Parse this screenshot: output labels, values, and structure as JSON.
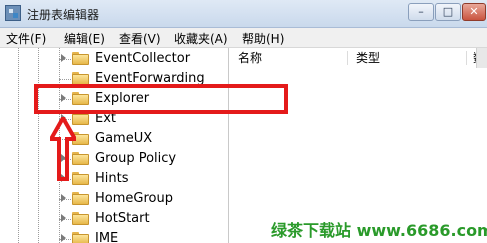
{
  "window": {
    "title": "注册表编辑器"
  },
  "menu": {
    "items": [
      {
        "label": "文件(F)"
      },
      {
        "label": "编辑(E)"
      },
      {
        "label": "查看(V)"
      },
      {
        "label": "收藏夹(A)"
      },
      {
        "label": "帮助(H)"
      }
    ]
  },
  "tree": {
    "items": [
      {
        "label": "EventCollector"
      },
      {
        "label": "EventForwarding"
      },
      {
        "label": "Explorer"
      },
      {
        "label": "Ext"
      },
      {
        "label": "GameUX"
      },
      {
        "label": "Group Policy"
      },
      {
        "label": "Hints"
      },
      {
        "label": "HomeGroup"
      },
      {
        "label": "HotStart"
      },
      {
        "label": "IME"
      }
    ]
  },
  "list": {
    "columns": [
      {
        "label": "名称"
      },
      {
        "label": "类型"
      },
      {
        "label": "数"
      }
    ]
  },
  "watermark": {
    "text": "绿茶下载站 www.6686.com"
  },
  "colors": {
    "annotation": "#e41a1a",
    "watermark": "#2a9a2a"
  }
}
